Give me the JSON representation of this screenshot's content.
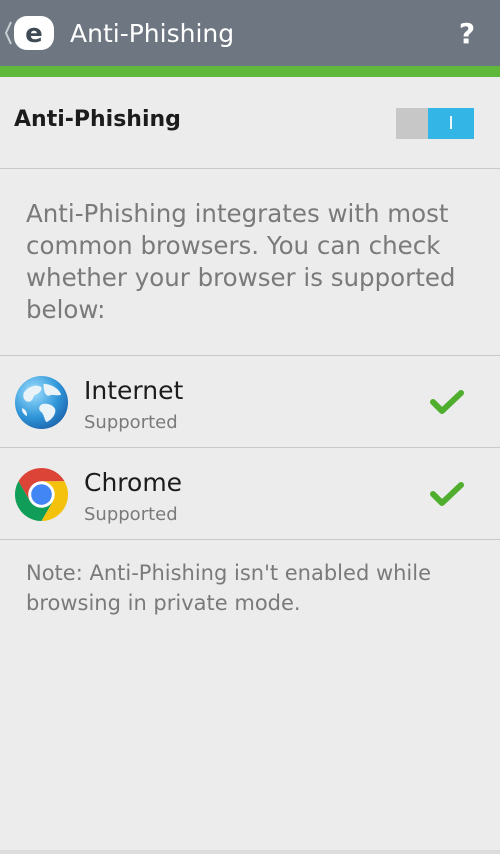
{
  "action_bar": {
    "title": "Anti-Phishing",
    "help_label": "?",
    "background": "#6e7781",
    "accent": "#5fb83a"
  },
  "toggle": {
    "label": "Anti-Phishing",
    "state_glyph": "I",
    "is_on": true,
    "on_color": "#33b5e5"
  },
  "description": "Anti-Phishing integrates with most common browsers. You can check whether your browser is supported below:",
  "browsers": [
    {
      "name": "Internet",
      "status": "Supported",
      "icon": "globe-icon",
      "supported": true
    },
    {
      "name": "Chrome",
      "status": "Supported",
      "icon": "chrome-icon",
      "supported": true
    }
  ],
  "note": "Note: Anti-Phishing isn't enabled while browsing in private mode."
}
